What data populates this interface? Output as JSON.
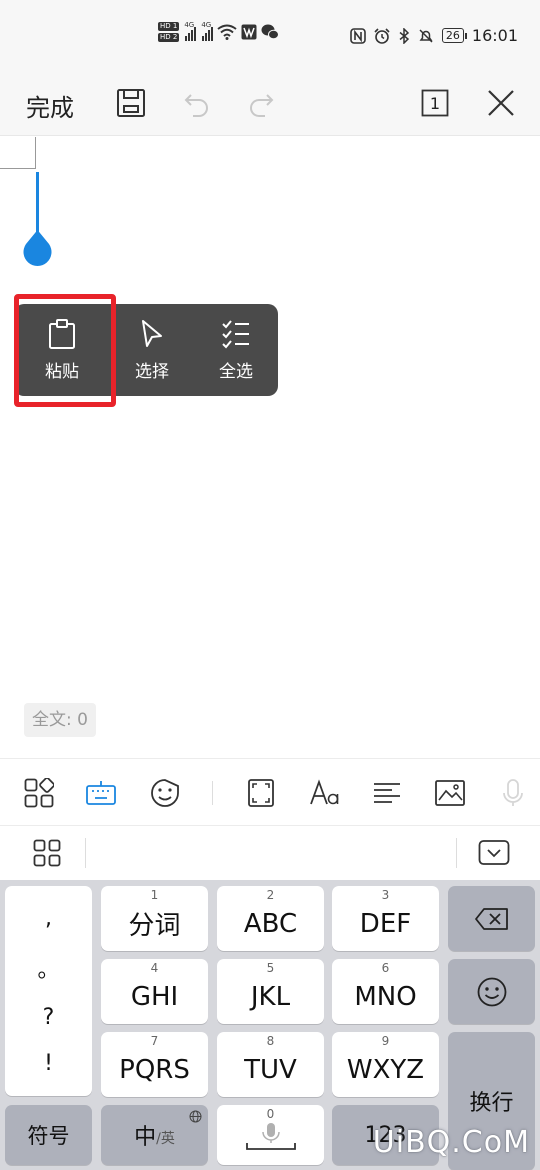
{
  "status_bar": {
    "hd1": "HD 1",
    "hd2": "HD 2",
    "net1": "4G",
    "net2": "4G",
    "battery": "26",
    "time": "16:01"
  },
  "toolbar": {
    "done_label": "完成",
    "page_number": "1"
  },
  "context_menu": {
    "items": [
      {
        "label": "粘贴",
        "icon": "clipboard-icon"
      },
      {
        "label": "选择",
        "icon": "pointer-icon"
      },
      {
        "label": "全选",
        "icon": "checklist-icon"
      }
    ]
  },
  "word_count": "全文: 0",
  "keyboard": {
    "punct": [
      ",",
      "。",
      "?",
      "!"
    ],
    "rows": [
      [
        {
          "num": "1",
          "label": "分词"
        },
        {
          "num": "2",
          "label": "ABC"
        },
        {
          "num": "3",
          "label": "DEF"
        }
      ],
      [
        {
          "num": "4",
          "label": "GHI"
        },
        {
          "num": "5",
          "label": "JKL"
        },
        {
          "num": "6",
          "label": "MNO"
        }
      ],
      [
        {
          "num": "7",
          "label": "PQRS"
        },
        {
          "num": "8",
          "label": "TUV"
        },
        {
          "num": "9",
          "label": "WXYZ"
        }
      ]
    ],
    "symbols_label": "符号",
    "lang_label_main": "中",
    "lang_label_sub": "/英",
    "space_num": "0",
    "numbers_label": "123",
    "enter_label": "换行"
  },
  "watermark": "UiBQ.CoM",
  "colors": {
    "accent": "#1a86e0",
    "highlight": "#e8232a",
    "menu_bg": "#4a4a4a"
  }
}
